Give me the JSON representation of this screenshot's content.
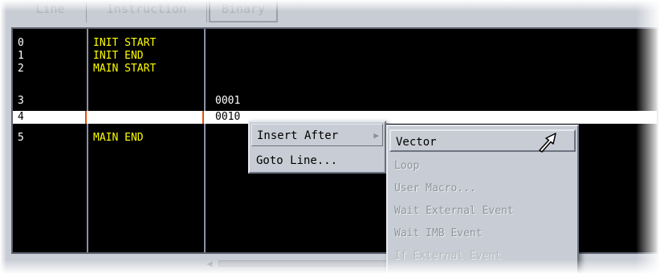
{
  "header": {
    "columns": [
      "Line",
      "Instruction",
      "Binary"
    ]
  },
  "listing": {
    "rows": [
      {
        "line": "0",
        "instruction": "INIT START",
        "binary": ""
      },
      {
        "line": "1",
        "instruction": "INIT END",
        "binary": ""
      },
      {
        "line": "2",
        "instruction": "MAIN START",
        "binary": ""
      },
      {
        "line": "3",
        "instruction": "",
        "binary": "0001"
      },
      {
        "line": "4",
        "instruction": "",
        "binary": "0010",
        "selected": true
      },
      {
        "line": "5",
        "instruction": "MAIN END",
        "binary": ""
      }
    ]
  },
  "context_menu": {
    "items": [
      "Insert After",
      "Goto Line..."
    ],
    "submenu_arrow_icon": "triangle-right-icon"
  },
  "submenu": {
    "items": [
      {
        "label": "Vector",
        "enabled": true,
        "highlighted": true
      },
      {
        "label": "Loop",
        "enabled": false
      },
      {
        "label": "User Macro...",
        "enabled": false
      },
      {
        "label": "Wait External Event",
        "enabled": false
      },
      {
        "label": "Wait IMB Event",
        "enabled": false
      },
      {
        "label": "If External Event",
        "enabled": false
      }
    ]
  },
  "colors": {
    "listing_bg": "#000000",
    "instruction_text": "#ffff00",
    "line_text": "#ffffff",
    "selected_row_bg": "#ffffff",
    "row_marker": "#e05010",
    "window_gray": "#c8ccd4"
  },
  "cursor": "mouse-pointer-icon"
}
